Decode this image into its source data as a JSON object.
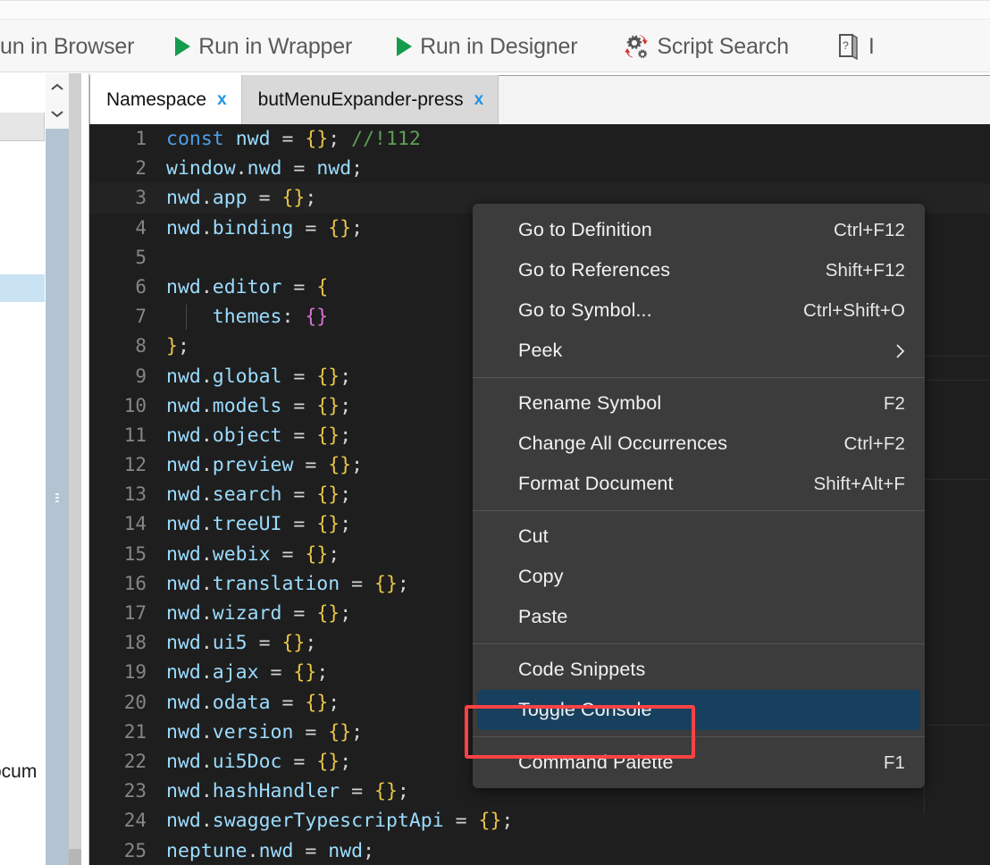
{
  "toolbar": {
    "items": [
      {
        "label": "un in Browser",
        "icon": "none",
        "truncated": true
      },
      {
        "label": "Run in Wrapper",
        "icon": "play-icon"
      },
      {
        "label": "Run in Designer",
        "icon": "play-icon"
      },
      {
        "label": "Script Search",
        "icon": "gear-refresh-icon"
      },
      {
        "label": "I",
        "icon": "book-help-icon",
        "truncated": true
      }
    ]
  },
  "tabs": [
    {
      "label": "Namespace",
      "close": "x",
      "active": true
    },
    {
      "label": "butMenuExpander-press",
      "close": "x",
      "active": false
    }
  ],
  "sidebar": {
    "partial_label": "ocum",
    "scroll_up": "chevron-up",
    "scroll_down": "chevron-down"
  },
  "editor": {
    "language": "javascript",
    "current_line": 3,
    "lines": [
      {
        "n": "1",
        "tokens": [
          {
            "t": "const",
            "c": "tk-key"
          },
          {
            "t": " ",
            "c": "tk-plain"
          },
          {
            "t": "nwd",
            "c": "tk-var"
          },
          {
            "t": " = ",
            "c": "tk-op"
          },
          {
            "t": "{}",
            "c": "tk-brace"
          },
          {
            "t": "; ",
            "c": "tk-plain"
          },
          {
            "t": "//!112",
            "c": "tk-cmt"
          }
        ]
      },
      {
        "n": "2",
        "tokens": [
          {
            "t": "window",
            "c": "tk-var"
          },
          {
            "t": ".",
            "c": "tk-plain"
          },
          {
            "t": "nwd",
            "c": "tk-var"
          },
          {
            "t": " = ",
            "c": "tk-op"
          },
          {
            "t": "nwd",
            "c": "tk-var"
          },
          {
            "t": ";",
            "c": "tk-plain"
          }
        ]
      },
      {
        "n": "3",
        "tokens": [
          {
            "t": "nwd",
            "c": "tk-var"
          },
          {
            "t": ".",
            "c": "tk-plain"
          },
          {
            "t": "app",
            "c": "tk-var"
          },
          {
            "t": " = ",
            "c": "tk-op"
          },
          {
            "t": "{}",
            "c": "tk-brace"
          },
          {
            "t": ";",
            "c": "tk-plain"
          }
        ]
      },
      {
        "n": "4",
        "tokens": [
          {
            "t": "nwd",
            "c": "tk-var"
          },
          {
            "t": ".",
            "c": "tk-plain"
          },
          {
            "t": "binding",
            "c": "tk-var"
          },
          {
            "t": " = ",
            "c": "tk-op"
          },
          {
            "t": "{}",
            "c": "tk-brace"
          },
          {
            "t": ";",
            "c": "tk-plain"
          }
        ]
      },
      {
        "n": "5",
        "tokens": []
      },
      {
        "n": "6",
        "tokens": [
          {
            "t": "nwd",
            "c": "tk-var"
          },
          {
            "t": ".",
            "c": "tk-plain"
          },
          {
            "t": "editor",
            "c": "tk-var"
          },
          {
            "t": " = ",
            "c": "tk-op"
          },
          {
            "t": "{",
            "c": "tk-brace"
          }
        ]
      },
      {
        "n": "7",
        "tokens": [
          {
            "t": "    ",
            "c": "tk-plain"
          },
          {
            "t": "themes",
            "c": "tk-var"
          },
          {
            "t": ": ",
            "c": "tk-plain"
          },
          {
            "t": "{}",
            "c": "tk-brace2"
          }
        ]
      },
      {
        "n": "8",
        "tokens": [
          {
            "t": "}",
            "c": "tk-brace"
          },
          {
            "t": ";",
            "c": "tk-plain"
          }
        ]
      },
      {
        "n": "9",
        "tokens": [
          {
            "t": "nwd",
            "c": "tk-var"
          },
          {
            "t": ".",
            "c": "tk-plain"
          },
          {
            "t": "global",
            "c": "tk-var"
          },
          {
            "t": " = ",
            "c": "tk-op"
          },
          {
            "t": "{}",
            "c": "tk-brace"
          },
          {
            "t": ";",
            "c": "tk-plain"
          }
        ]
      },
      {
        "n": "10",
        "tokens": [
          {
            "t": "nwd",
            "c": "tk-var"
          },
          {
            "t": ".",
            "c": "tk-plain"
          },
          {
            "t": "models",
            "c": "tk-var"
          },
          {
            "t": " = ",
            "c": "tk-op"
          },
          {
            "t": "{}",
            "c": "tk-brace"
          },
          {
            "t": ";",
            "c": "tk-plain"
          }
        ]
      },
      {
        "n": "11",
        "tokens": [
          {
            "t": "nwd",
            "c": "tk-var"
          },
          {
            "t": ".",
            "c": "tk-plain"
          },
          {
            "t": "object",
            "c": "tk-var"
          },
          {
            "t": " = ",
            "c": "tk-op"
          },
          {
            "t": "{}",
            "c": "tk-brace"
          },
          {
            "t": ";",
            "c": "tk-plain"
          }
        ]
      },
      {
        "n": "12",
        "tokens": [
          {
            "t": "nwd",
            "c": "tk-var"
          },
          {
            "t": ".",
            "c": "tk-plain"
          },
          {
            "t": "preview",
            "c": "tk-var"
          },
          {
            "t": " = ",
            "c": "tk-op"
          },
          {
            "t": "{}",
            "c": "tk-brace"
          },
          {
            "t": ";",
            "c": "tk-plain"
          }
        ]
      },
      {
        "n": "13",
        "tokens": [
          {
            "t": "nwd",
            "c": "tk-var"
          },
          {
            "t": ".",
            "c": "tk-plain"
          },
          {
            "t": "search",
            "c": "tk-var"
          },
          {
            "t": " = ",
            "c": "tk-op"
          },
          {
            "t": "{}",
            "c": "tk-brace"
          },
          {
            "t": ";",
            "c": "tk-plain"
          }
        ]
      },
      {
        "n": "14",
        "tokens": [
          {
            "t": "nwd",
            "c": "tk-var"
          },
          {
            "t": ".",
            "c": "tk-plain"
          },
          {
            "t": "treeUI",
            "c": "tk-var"
          },
          {
            "t": " = ",
            "c": "tk-op"
          },
          {
            "t": "{}",
            "c": "tk-brace"
          },
          {
            "t": ";",
            "c": "tk-plain"
          }
        ]
      },
      {
        "n": "15",
        "tokens": [
          {
            "t": "nwd",
            "c": "tk-var"
          },
          {
            "t": ".",
            "c": "tk-plain"
          },
          {
            "t": "webix",
            "c": "tk-var"
          },
          {
            "t": " = ",
            "c": "tk-op"
          },
          {
            "t": "{}",
            "c": "tk-brace"
          },
          {
            "t": ";",
            "c": "tk-plain"
          }
        ]
      },
      {
        "n": "16",
        "tokens": [
          {
            "t": "nwd",
            "c": "tk-var"
          },
          {
            "t": ".",
            "c": "tk-plain"
          },
          {
            "t": "translation",
            "c": "tk-var"
          },
          {
            "t": " = ",
            "c": "tk-op"
          },
          {
            "t": "{}",
            "c": "tk-brace"
          },
          {
            "t": ";",
            "c": "tk-plain"
          }
        ]
      },
      {
        "n": "17",
        "tokens": [
          {
            "t": "nwd",
            "c": "tk-var"
          },
          {
            "t": ".",
            "c": "tk-plain"
          },
          {
            "t": "wizard",
            "c": "tk-var"
          },
          {
            "t": " = ",
            "c": "tk-op"
          },
          {
            "t": "{}",
            "c": "tk-brace"
          },
          {
            "t": ";",
            "c": "tk-plain"
          }
        ]
      },
      {
        "n": "18",
        "tokens": [
          {
            "t": "nwd",
            "c": "tk-var"
          },
          {
            "t": ".",
            "c": "tk-plain"
          },
          {
            "t": "ui5",
            "c": "tk-var"
          },
          {
            "t": " = ",
            "c": "tk-op"
          },
          {
            "t": "{}",
            "c": "tk-brace"
          },
          {
            "t": ";",
            "c": "tk-plain"
          }
        ]
      },
      {
        "n": "19",
        "tokens": [
          {
            "t": "nwd",
            "c": "tk-var"
          },
          {
            "t": ".",
            "c": "tk-plain"
          },
          {
            "t": "ajax",
            "c": "tk-var"
          },
          {
            "t": " = ",
            "c": "tk-op"
          },
          {
            "t": "{}",
            "c": "tk-brace"
          },
          {
            "t": ";",
            "c": "tk-plain"
          }
        ]
      },
      {
        "n": "20",
        "tokens": [
          {
            "t": "nwd",
            "c": "tk-var"
          },
          {
            "t": ".",
            "c": "tk-plain"
          },
          {
            "t": "odata",
            "c": "tk-var"
          },
          {
            "t": " = ",
            "c": "tk-op"
          },
          {
            "t": "{}",
            "c": "tk-brace"
          },
          {
            "t": ";",
            "c": "tk-plain"
          }
        ]
      },
      {
        "n": "21",
        "tokens": [
          {
            "t": "nwd",
            "c": "tk-var"
          },
          {
            "t": ".",
            "c": "tk-plain"
          },
          {
            "t": "version",
            "c": "tk-var"
          },
          {
            "t": " = ",
            "c": "tk-op"
          },
          {
            "t": "{}",
            "c": "tk-brace"
          },
          {
            "t": ";",
            "c": "tk-plain"
          }
        ]
      },
      {
        "n": "22",
        "tokens": [
          {
            "t": "nwd",
            "c": "tk-var"
          },
          {
            "t": ".",
            "c": "tk-plain"
          },
          {
            "t": "ui5Doc",
            "c": "tk-var"
          },
          {
            "t": " = ",
            "c": "tk-op"
          },
          {
            "t": "{}",
            "c": "tk-brace"
          },
          {
            "t": ";",
            "c": "tk-plain"
          }
        ]
      },
      {
        "n": "23",
        "tokens": [
          {
            "t": "nwd",
            "c": "tk-var"
          },
          {
            "t": ".",
            "c": "tk-plain"
          },
          {
            "t": "hashHandler",
            "c": "tk-var"
          },
          {
            "t": " = ",
            "c": "tk-op"
          },
          {
            "t": "{}",
            "c": "tk-brace"
          },
          {
            "t": ";",
            "c": "tk-plain"
          }
        ]
      },
      {
        "n": "24",
        "tokens": [
          {
            "t": "nwd",
            "c": "tk-var"
          },
          {
            "t": ".",
            "c": "tk-plain"
          },
          {
            "t": "swaggerTypescriptApi",
            "c": "tk-var"
          },
          {
            "t": " = ",
            "c": "tk-op"
          },
          {
            "t": "{}",
            "c": "tk-brace"
          },
          {
            "t": ";",
            "c": "tk-plain"
          }
        ]
      },
      {
        "n": "25",
        "tokens": [
          {
            "t": "neptune",
            "c": "tk-var"
          },
          {
            "t": ".",
            "c": "tk-plain"
          },
          {
            "t": "nwd",
            "c": "tk-var"
          },
          {
            "t": " = ",
            "c": "tk-op"
          },
          {
            "t": "nwd",
            "c": "tk-var"
          },
          {
            "t": ";",
            "c": "tk-plain"
          }
        ]
      }
    ]
  },
  "context_menu": {
    "sections": [
      {
        "items": [
          {
            "label": "Go to Definition",
            "shortcut": "Ctrl+F12"
          },
          {
            "label": "Go to References",
            "shortcut": "Shift+F12"
          },
          {
            "label": "Go to Symbol...",
            "shortcut": "Ctrl+Shift+O"
          },
          {
            "label": "Peek",
            "shortcut": "",
            "submenu": true
          }
        ]
      },
      {
        "items": [
          {
            "label": "Rename Symbol",
            "shortcut": "F2"
          },
          {
            "label": "Change All Occurrences",
            "shortcut": "Ctrl+F2"
          },
          {
            "label": "Format Document",
            "shortcut": "Shift+Alt+F"
          }
        ]
      },
      {
        "items": [
          {
            "label": "Cut",
            "shortcut": ""
          },
          {
            "label": "Copy",
            "shortcut": ""
          },
          {
            "label": "Paste",
            "shortcut": ""
          }
        ]
      },
      {
        "items": [
          {
            "label": "Code Snippets",
            "shortcut": ""
          },
          {
            "label": "Toggle Console",
            "shortcut": "",
            "highlighted": true
          }
        ]
      },
      {
        "items": [
          {
            "label": "Command Palette",
            "shortcut": "F1"
          }
        ]
      }
    ]
  },
  "annotation": {
    "target": "Toggle Console",
    "color": "#fd4245"
  },
  "colors": {
    "editor_bg": "#1e1e1e",
    "menu_bg": "#3c3c3c",
    "menu_highlight": "#17405f",
    "accent_green": "#169c4e",
    "accent_blue": "#2196e0",
    "annotation_red": "#fd4245"
  }
}
